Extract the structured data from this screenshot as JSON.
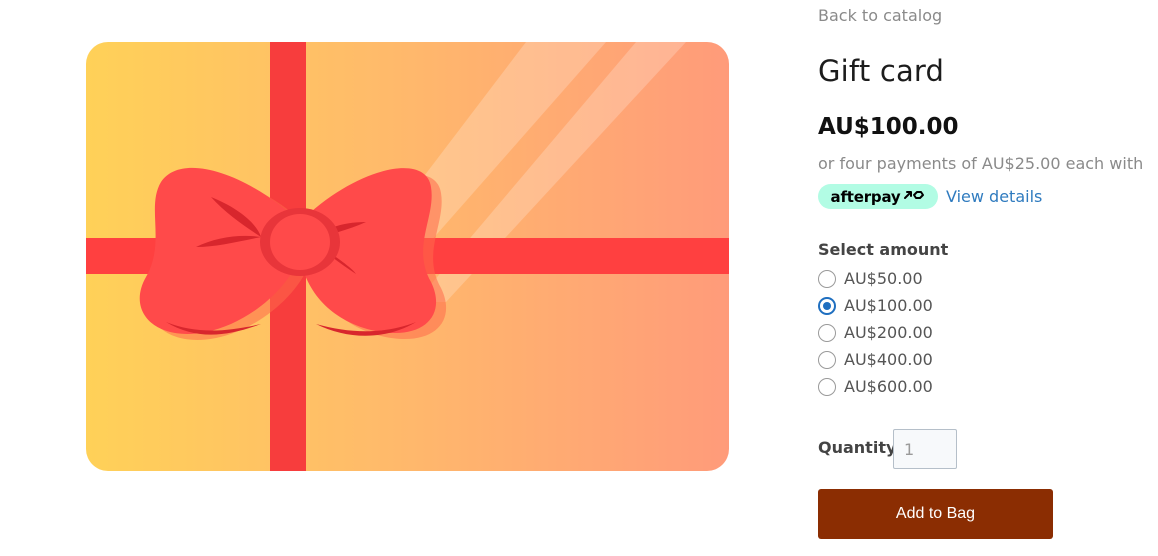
{
  "product": {
    "back_link": "Back to catalog",
    "title": "Gift card",
    "price": "AU$100.00",
    "afterpay_text": "or four payments of AU$25.00 each with",
    "afterpay_badge": "afterpay",
    "view_details": "View details",
    "select_label": "Select amount",
    "amounts": [
      {
        "label": "AU$50.00",
        "checked": false
      },
      {
        "label": "AU$100.00",
        "checked": true
      },
      {
        "label": "AU$200.00",
        "checked": false
      },
      {
        "label": "AU$400.00",
        "checked": false
      },
      {
        "label": "AU$600.00",
        "checked": false
      }
    ],
    "quantity_label": "Quantity:",
    "quantity_value": "1",
    "add_button": "Add to Bag"
  },
  "colors": {
    "card_start": "#ffd05a",
    "card_end": "#ff9a78",
    "ribbon": "#ff4040",
    "afterpay_mint": "#b2fce4",
    "button": "#8b2d02",
    "link": "#2f7bbf",
    "radio_checked": "#1f6fc0"
  },
  "icons": {
    "card_image": "gift-card-ribbon-bow-image",
    "afterpay_logo": "afterpay-arrows-icon"
  }
}
